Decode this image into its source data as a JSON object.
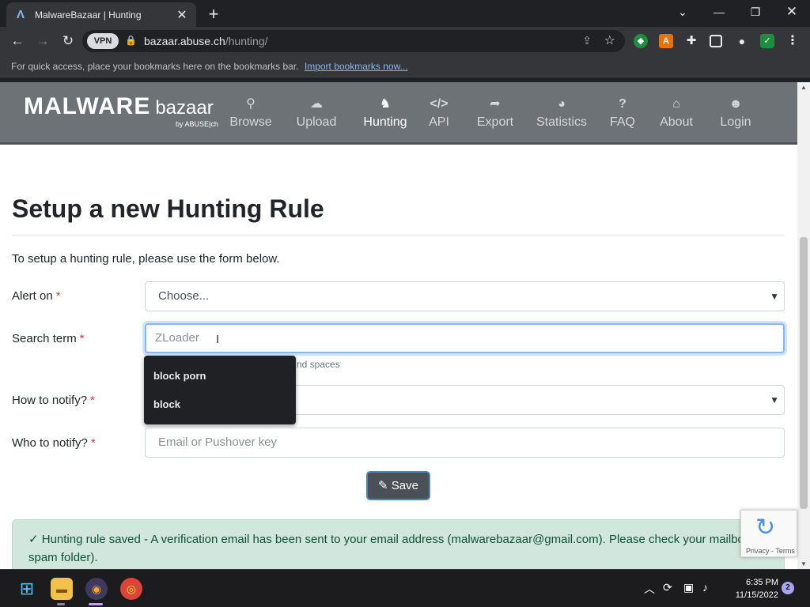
{
  "browser": {
    "tab_title": "MalwareBazaar | Hunting",
    "tab_favicon": "Λ",
    "url_host": "bazaar.abuse.ch",
    "url_path": "/hunting/",
    "vpn_label": "VPN",
    "bookmarks_bar_text": "For quick access, place your bookmarks here on the bookmarks bar.",
    "bookmarks_bar_link": "Import bookmarks now..."
  },
  "site": {
    "logo_main": "MALWARE",
    "logo_sub": "bazaar",
    "logo_by": "by ABUSE|ch",
    "nav": [
      {
        "label": "Browse",
        "icon": "search-icon"
      },
      {
        "label": "Upload",
        "icon": "upload-icon"
      },
      {
        "label": "Hunting",
        "icon": "cat-icon",
        "active": true
      },
      {
        "label": "API",
        "icon": "code-icon"
      },
      {
        "label": "Export",
        "icon": "export-icon"
      },
      {
        "label": "Statistics",
        "icon": "pie-chart-icon"
      },
      {
        "label": "FAQ",
        "icon": "question-icon"
      },
      {
        "label": "About",
        "icon": "building-icon"
      },
      {
        "label": "Login",
        "icon": "user-icon"
      }
    ]
  },
  "form": {
    "heading": "Setup a new Hunting Rule",
    "intro": "To setup a hunting rule, please use the form below.",
    "required_mark": "*",
    "alert_on_label": "Alert on",
    "alert_on_value": "Choose...",
    "search_term_label": "Search term",
    "search_term_placeholder": "ZLoader",
    "search_term_help_visible": "nd spaces",
    "how_to_notify_label": "How to notify?",
    "who_to_notify_label": "Who to notify?",
    "who_to_notify_placeholder": "Email or Pushover key",
    "save_label": "Save",
    "autocomplete": [
      "block porn",
      "block"
    ]
  },
  "alert": {
    "text": "Hunting rule saved - A verification email has been sent to your email address (malwarebazaar@gmail.com). Please check your mailbox (and spam folder)."
  },
  "recaptcha": {
    "links": "Privacy - Terms"
  },
  "taskbar": {
    "time": "6:35 PM",
    "date": "11/15/2022",
    "notification_count": "2"
  }
}
